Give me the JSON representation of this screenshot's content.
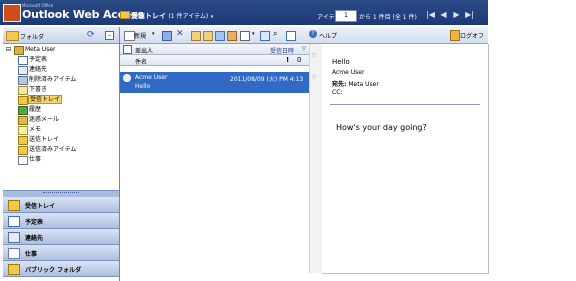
{
  "header": {
    "brand_small": "Microsoft Office",
    "brand_title": "Outlook Web Access",
    "folder_title": "受信トレイ",
    "folder_count": "(1 件アイテム)",
    "item_label": "アイテム",
    "page_value": "1",
    "page_count": "から 1 件目 (全 1 件)",
    "nav": [
      "|◀",
      "◀",
      "▶",
      "▶|"
    ]
  },
  "left_pane": {
    "folder_header": "フォルダ",
    "tree": [
      {
        "label": "Meta User",
        "icon": "mailbox-icon",
        "indent": 0,
        "expander": "⊟"
      },
      {
        "label": "予定表",
        "icon": "calendar-icon",
        "indent": 1
      },
      {
        "label": "連絡先",
        "icon": "contacts-icon",
        "indent": 1
      },
      {
        "label": "削除済みアイテム",
        "icon": "trash-icon",
        "indent": 1
      },
      {
        "label": "下書き",
        "icon": "drafts-icon",
        "indent": 1
      },
      {
        "label": "受信トレイ",
        "icon": "inbox-icon",
        "indent": 1,
        "selected": true
      },
      {
        "label": "履歴",
        "icon": "journal-icon",
        "indent": 1
      },
      {
        "label": "迷惑メール",
        "icon": "junk-mail-icon",
        "indent": 1
      },
      {
        "label": "メモ",
        "icon": "notes-icon",
        "indent": 1
      },
      {
        "label": "送信トレイ",
        "icon": "outbox-icon",
        "indent": 1
      },
      {
        "label": "送信済みアイテム",
        "icon": "sent-items-icon",
        "indent": 1
      },
      {
        "label": "仕事",
        "icon": "tasks-icon",
        "indent": 1
      }
    ],
    "nav_groups": [
      {
        "label": "受信トレイ",
        "icon": "inbox-icon"
      },
      {
        "label": "予定表",
        "icon": "calendar-icon"
      },
      {
        "label": "連絡先",
        "icon": "contacts-icon"
      },
      {
        "label": "仕事",
        "icon": "tasks-icon"
      },
      {
        "label": "パブリック フォルダ",
        "icon": "public-folder-icon"
      }
    ]
  },
  "toolbar": {
    "new_label": "新規",
    "help_label": "ヘルプ",
    "logoff_label": "ログオフ"
  },
  "message_list": {
    "col_from": "差出人",
    "col_received": "受信日時",
    "col_subject": "件名",
    "col_importance": "!",
    "col_attachment": "0",
    "rows": [
      {
        "from": "Acme User",
        "date": "2011/08/09 (火) PM 4:13",
        "subject": "Hello"
      }
    ]
  },
  "reading_pane": {
    "subject": "Hello",
    "from": "Acme User",
    "to_label": "宛先:",
    "to_value": "Meta User",
    "cc_label": "CC:",
    "body": "How's your day going?"
  },
  "colors": {
    "header_bg": "#1f3d7c",
    "selection": "#316ac5",
    "folder_selected": "#f3d36b",
    "nav_group": "#bccbe7"
  }
}
